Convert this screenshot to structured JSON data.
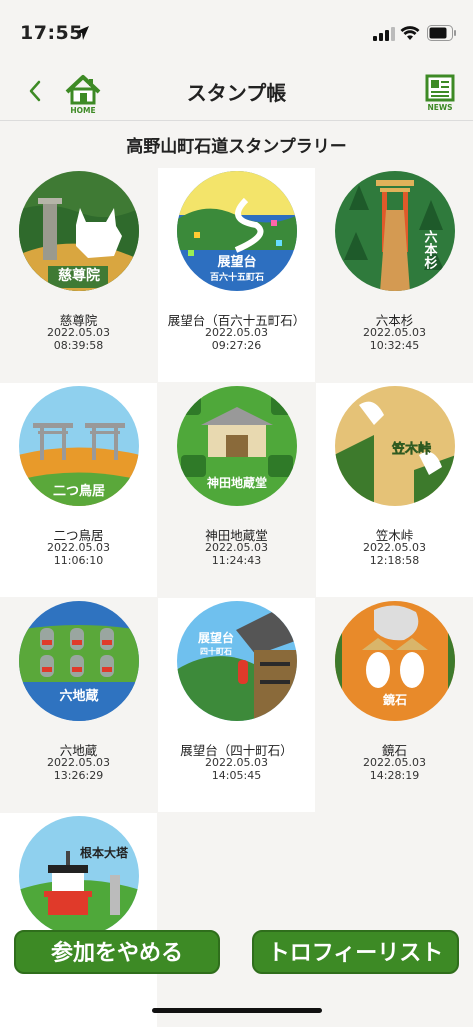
{
  "status": {
    "time": "17:55"
  },
  "nav": {
    "title": "スタンプ帳",
    "home_label": "HOME",
    "news_label": "NEWS"
  },
  "heading": "高野山町石道スタンプラリー",
  "colors": {
    "accent": "#3d8a25",
    "background": "#f5f4f2"
  },
  "stamps": [
    {
      "name": "慈尊院",
      "date": "2022.05.03",
      "time": "08:39:58",
      "label": "慈尊院",
      "label2": ""
    },
    {
      "name": "展望台（百六十五町石）",
      "date": "2022.05.03",
      "time": "09:27:26",
      "label": "展望台",
      "label2": "百六十五町石"
    },
    {
      "name": "六本杉",
      "date": "2022.05.03",
      "time": "10:32:45",
      "label": "六本杉",
      "label2": ""
    },
    {
      "name": "二つ鳥居",
      "date": "2022.05.03",
      "time": "11:06:10",
      "label": "二つ鳥居",
      "label2": ""
    },
    {
      "name": "神田地蔵堂",
      "date": "2022.05.03",
      "time": "11:24:43",
      "label": "神田地蔵堂",
      "label2": ""
    },
    {
      "name": "笠木峠",
      "date": "2022.05.03",
      "time": "12:18:58",
      "label": "笠木峠",
      "label2": ""
    },
    {
      "name": "六地蔵",
      "date": "2022.05.03",
      "time": "13:26:29",
      "label": "六地蔵",
      "label2": ""
    },
    {
      "name": "展望台（四十町石）",
      "date": "2022.05.03",
      "time": "14:05:45",
      "label": "展望台",
      "label2": "四十町石"
    },
    {
      "name": "鏡石",
      "date": "2022.05.03",
      "time": "14:28:19",
      "label": "鏡石",
      "label2": ""
    },
    {
      "name": "",
      "date": "",
      "time": "",
      "label": "根本大塔",
      "label2": ""
    }
  ],
  "buttons": {
    "quit": "参加をやめる",
    "trophy": "トロフィーリスト"
  }
}
